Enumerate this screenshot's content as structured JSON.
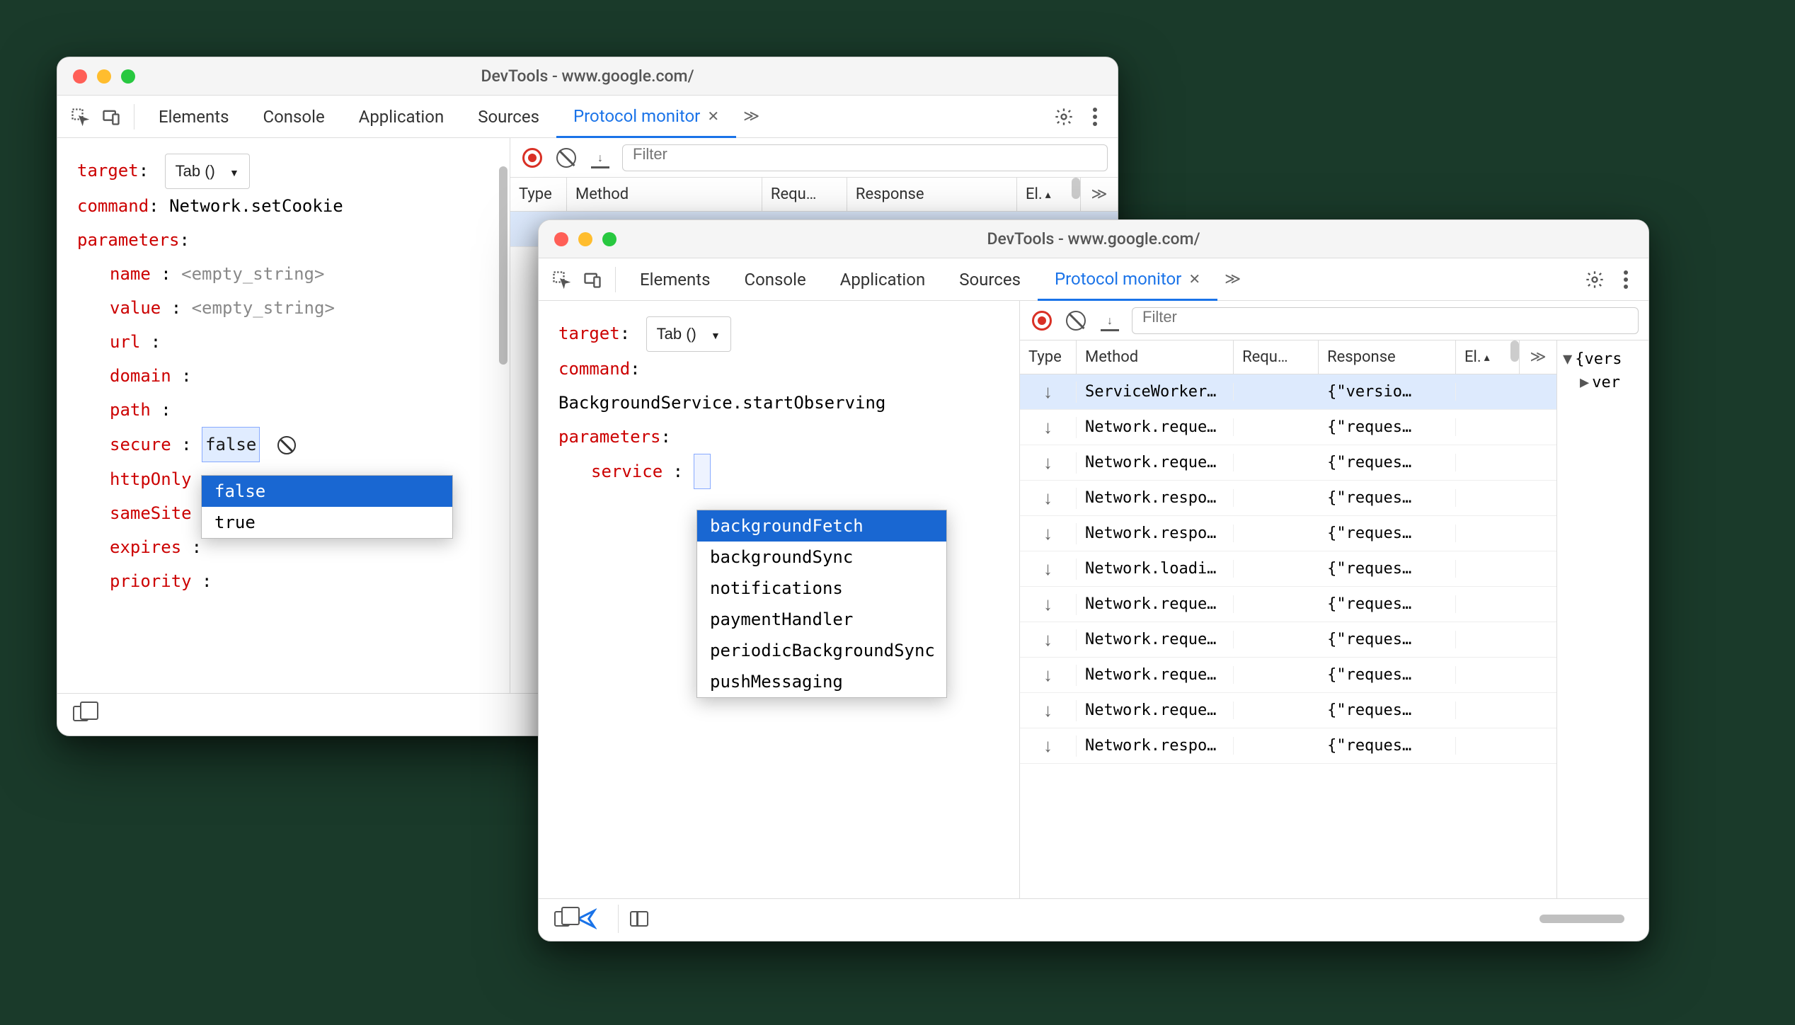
{
  "window1": {
    "title": "DevTools - www.google.com/",
    "tabs": [
      "Elements",
      "Console",
      "Application",
      "Sources",
      "Protocol monitor"
    ],
    "activeTab": "Protocol monitor",
    "left": {
      "target_label": "target",
      "target_value": "Tab ()",
      "command_label": "command",
      "command_value": "Network.setCookie",
      "parameters_label": "parameters",
      "params": {
        "name": "name",
        "name_val": "<empty_string>",
        "value": "value",
        "value_val": "<empty_string>",
        "url": "url",
        "domain": "domain",
        "path": "path",
        "secure": "secure",
        "secure_val": "false",
        "httpOnly": "httpOnly",
        "sameSite": "sameSite",
        "expires": "expires",
        "priority": "priority"
      },
      "dropdown": [
        "false",
        "true"
      ]
    },
    "right": {
      "filter_placeholder": "Filter",
      "columns": {
        "type": "Type",
        "method": "Method",
        "req": "Requ…",
        "resp": "Response",
        "el": "El.",
        "chev": "≫"
      }
    }
  },
  "window2": {
    "title": "DevTools - www.google.com/",
    "tabs": [
      "Elements",
      "Console",
      "Application",
      "Sources",
      "Protocol monitor"
    ],
    "activeTab": "Protocol monitor",
    "left": {
      "target_label": "target",
      "target_value": "Tab ()",
      "command_label": "command",
      "command_value": "BackgroundService.startObserving",
      "parameters_label": "parameters",
      "params": {
        "service": "service"
      },
      "dropdown": [
        "backgroundFetch",
        "backgroundSync",
        "notifications",
        "paymentHandler",
        "periodicBackgroundSync",
        "pushMessaging"
      ]
    },
    "right": {
      "filter_placeholder": "Filter",
      "columns": {
        "type": "Type",
        "method": "Method",
        "req": "Requ…",
        "resp": "Response",
        "el": "El.",
        "chev": "≫"
      },
      "rows": [
        {
          "method": "ServiceWorker…",
          "resp": "{\"versio…",
          "selected": true
        },
        {
          "method": "Network.reque…",
          "resp": "{\"reques…"
        },
        {
          "method": "Network.reque…",
          "resp": "{\"reques…"
        },
        {
          "method": "Network.respo…",
          "resp": "{\"reques…"
        },
        {
          "method": "Network.respo…",
          "resp": "{\"reques…"
        },
        {
          "method": "Network.loadi…",
          "resp": "{\"reques…"
        },
        {
          "method": "Network.reque…",
          "resp": "{\"reques…"
        },
        {
          "method": "Network.reque…",
          "resp": "{\"reques…"
        },
        {
          "method": "Network.reque…",
          "resp": "{\"reques…"
        },
        {
          "method": "Network.reque…",
          "resp": "{\"reques…"
        },
        {
          "method": "Network.respo…",
          "resp": "{\"reques…"
        }
      ],
      "inspector": {
        "root": "{vers",
        "child": "ver"
      }
    }
  }
}
